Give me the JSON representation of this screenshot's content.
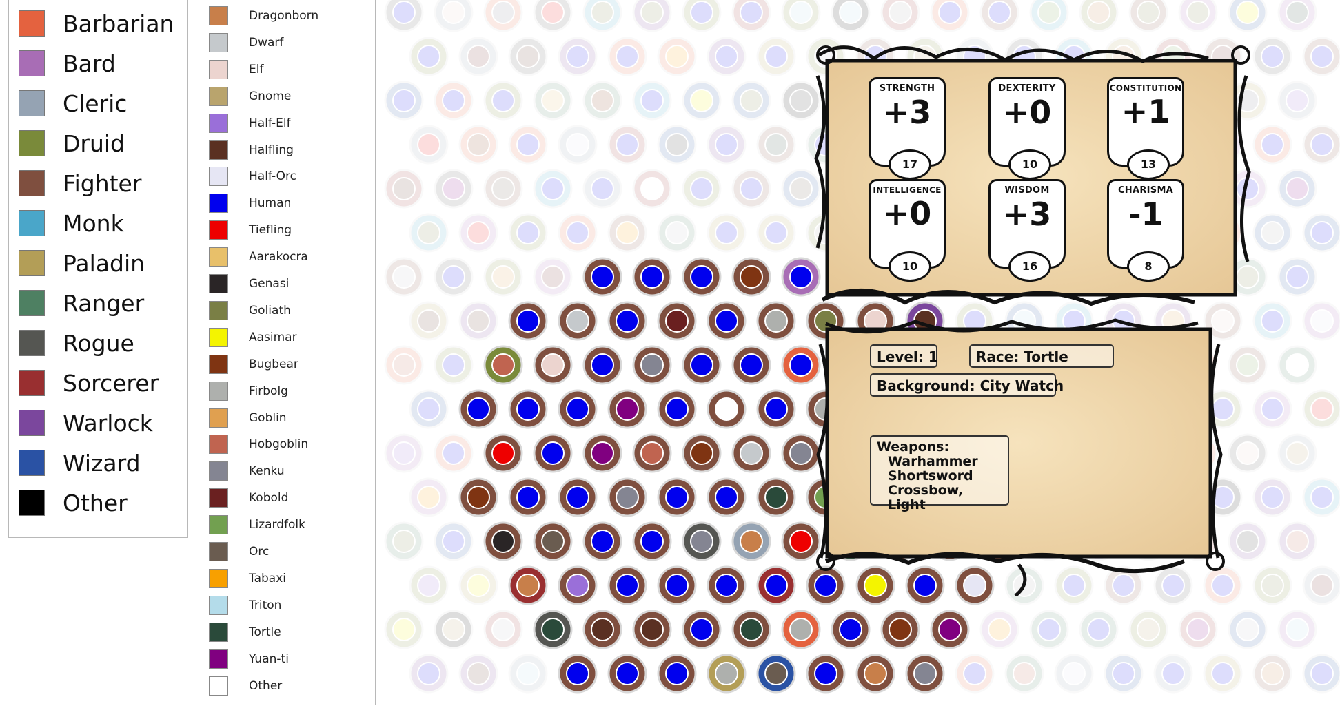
{
  "class_legend": [
    {
      "label": "Barbarian",
      "color": "#e4623f"
    },
    {
      "label": "Bard",
      "color": "#a86db5"
    },
    {
      "label": "Cleric",
      "color": "#95a3b3"
    },
    {
      "label": "Druid",
      "color": "#7a8a3a"
    },
    {
      "label": "Fighter",
      "color": "#7f4f3f"
    },
    {
      "label": "Monk",
      "color": "#4aa6c9"
    },
    {
      "label": "Paladin",
      "color": "#b39e57"
    },
    {
      "label": "Ranger",
      "color": "#4e8062"
    },
    {
      "label": "Rogue",
      "color": "#555652"
    },
    {
      "label": "Sorcerer",
      "color": "#992f30"
    },
    {
      "label": "Warlock",
      "color": "#7b479d"
    },
    {
      "label": "Wizard",
      "color": "#2a52a4"
    },
    {
      "label": "Other",
      "color": "#000000"
    }
  ],
  "race_legend": [
    {
      "label": "Dragonborn",
      "color": "#c87f4a"
    },
    {
      "label": "Dwarf",
      "color": "#c5c9cc"
    },
    {
      "label": "Elf",
      "color": "#ecd4cf"
    },
    {
      "label": "Gnome",
      "color": "#b9a46d"
    },
    {
      "label": "Half-Elf",
      "color": "#9a6fd9"
    },
    {
      "label": "Halfling",
      "color": "#5a3022"
    },
    {
      "label": "Half-Orc",
      "color": "#e6e6f4"
    },
    {
      "label": "Human",
      "color": "#0000ee"
    },
    {
      "label": "Tiefling",
      "color": "#ee0000"
    },
    {
      "label": "Aarakocra",
      "color": "#e8c06a"
    },
    {
      "label": "Genasi",
      "color": "#2a2526"
    },
    {
      "label": "Goliath",
      "color": "#7a7f45"
    },
    {
      "label": "Aasimar",
      "color": "#f4f400"
    },
    {
      "label": "Bugbear",
      "color": "#7f3412"
    },
    {
      "label": "Firbolg",
      "color": "#aeb0ad"
    },
    {
      "label": "Goblin",
      "color": "#e0a050"
    },
    {
      "label": "Hobgoblin",
      "color": "#c06450"
    },
    {
      "label": "Kenku",
      "color": "#848592"
    },
    {
      "label": "Kobold",
      "color": "#6a2020"
    },
    {
      "label": "Lizardfolk",
      "color": "#72a050"
    },
    {
      "label": "Orc",
      "color": "#6a5c50"
    },
    {
      "label": "Tabaxi",
      "color": "#f8a000"
    },
    {
      "label": "Triton",
      "color": "#b4dcea"
    },
    {
      "label": "Tortle",
      "color": "#2a4a3a"
    },
    {
      "label": "Yuan-ti",
      "color": "#800080"
    },
    {
      "label": "Other",
      "color": "#ffffff"
    }
  ],
  "sheet": {
    "stats": [
      {
        "name": "STRENGTH",
        "modifier": "+3",
        "score": "17"
      },
      {
        "name": "DEXTERITY",
        "modifier": "+0",
        "score": "10"
      },
      {
        "name": "CONSTITUTION",
        "modifier": "+1",
        "score": "13"
      },
      {
        "name": "INTELLIGENCE",
        "modifier": "+0",
        "score": "10"
      },
      {
        "name": "WISDOM",
        "modifier": "+3",
        "score": "16"
      },
      {
        "name": "CHARISMA",
        "modifier": "-1",
        "score": "8"
      }
    ],
    "level": "Level: 1",
    "race": "Race: Tortle",
    "background": "Background: City Watch",
    "weapons_title": "Weapons:",
    "weapons": [
      "Warhammer",
      "Shortsword",
      "Crossbow, Light"
    ]
  },
  "colors": {
    "fighter_ring": "#7f4f3f",
    "parchment": "#f0d9b0",
    "frame": "#111111"
  }
}
